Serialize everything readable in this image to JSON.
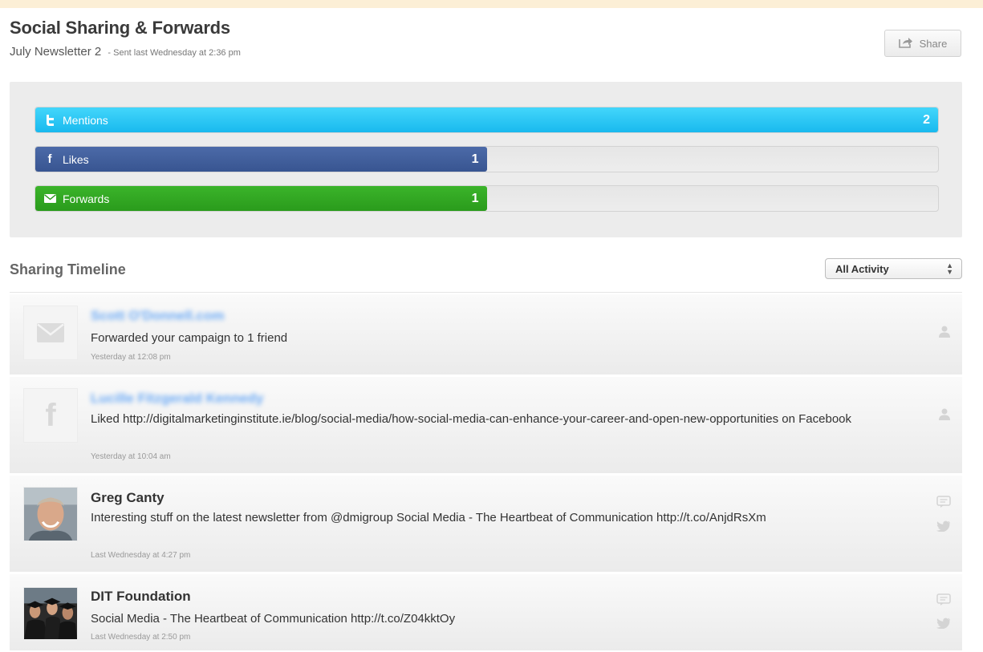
{
  "header": {
    "title": "Social Sharing & Forwards",
    "campaign_name": "July Newsletter 2",
    "sent_info": "- Sent last Wednesday at 2:36 pm",
    "share_label": "Share"
  },
  "stats": [
    {
      "label": "Mentions",
      "count": "2",
      "fill_fraction": 1.0,
      "icon": "twitter-icon",
      "color": "#19b9ee"
    },
    {
      "label": "Likes",
      "count": "1",
      "fill_fraction": 0.5,
      "icon": "facebook-icon",
      "color": "#385591"
    },
    {
      "label": "Forwards",
      "count": "1",
      "fill_fraction": 0.5,
      "icon": "envelope-icon",
      "color": "#2a9b1c"
    }
  ],
  "timeline": {
    "title": "Sharing Timeline",
    "filter_selected": "All Activity",
    "items": [
      {
        "name": "Scott O'Donnell.com",
        "text": "Forwarded your campaign to 1 friend",
        "time": "Yesterday at 12:08 pm",
        "avatar_icon": "envelope-icon",
        "side_icons": [
          "person-icon"
        ]
      },
      {
        "name": "Lucille Fitzgerald Kennedy",
        "text": "Liked http://digitalmarketinginstitute.ie/blog/social-media/how-social-media-can-enhance-your-career-and-open-new-opportunities on Facebook",
        "time": "Yesterday at 10:04 am",
        "avatar_icon": "facebook-icon",
        "side_icons": [
          "person-icon"
        ]
      },
      {
        "name": "Greg Canty",
        "text": "Interesting stuff on the latest newsletter from @dmigroup Social Media - The Heartbeat of Communication http://t.co/AnjdRsXm",
        "time": "Last Wednesday at 4:27 pm",
        "avatar_icon": "user-photo",
        "side_icons": [
          "reply-icon",
          "twitter-icon"
        ]
      },
      {
        "name": "DIT Foundation",
        "text": "Social Media - The Heartbeat of Communication http://t.co/Z04kktOy",
        "time": "Last Wednesday at 2:50 pm",
        "avatar_icon": "graduates-photo",
        "side_icons": [
          "reply-icon",
          "twitter-icon"
        ]
      }
    ]
  }
}
